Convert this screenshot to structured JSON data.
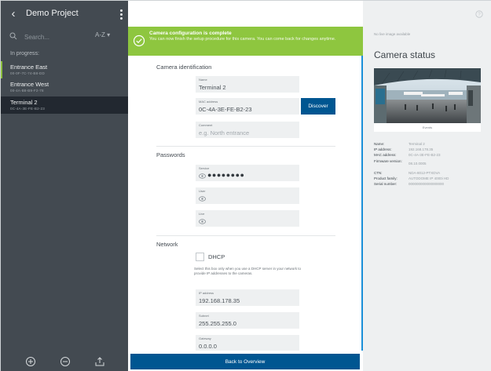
{
  "sidebar": {
    "project_title": "Demo Project",
    "search_placeholder": "Search...",
    "sort_label": "A-Z ▾",
    "section_label": "In progress:",
    "items": [
      {
        "name": "Entrance East",
        "mac": "00-0F-7C-74-B8-DD",
        "flag": true,
        "active": false
      },
      {
        "name": "Entrance West",
        "mac": "00-4A-B8-B9-F2-78",
        "flag": false,
        "active": false
      },
      {
        "name": "Terminal 2",
        "mac": "0C-4A-3E-FE-B2-23",
        "flag": false,
        "active": true
      }
    ],
    "footer_icons": [
      "add-circle-icon",
      "remove-circle-icon",
      "upload-icon"
    ]
  },
  "banner": {
    "title": "Camera configuration is complete",
    "text": "You can now finish the setup procedure for this camera. You can come back for changes anytime.",
    "color": "#8ec63f"
  },
  "identification": {
    "title": "Camera identification",
    "name_label": "Name",
    "name_value": "Terminal 2",
    "mac_label": "MAC address",
    "mac_value": "0C-4A-3E-FE-B2-23",
    "discover_label": "Discover",
    "comment_label": "Comment",
    "comment_placeholder": "e.g. North entrance"
  },
  "passwords": {
    "title": "Passwords",
    "service_label": "Service",
    "service_mask": "●●●●●●●●",
    "user_label": "User",
    "live_label": "Live"
  },
  "network": {
    "title": "Network",
    "dhcp_label": "DHCP",
    "dhcp_help": "Select this box only when you use a DHCP server in your network to provide IP addresses to the cameras.",
    "ip_label": "IP address",
    "ip_value": "192.168.178.35",
    "subnet_label": "Subnet",
    "subnet_value": "255.255.255.0",
    "gateway_label": "Gateway",
    "gateway_value": "0.0.0.0"
  },
  "footer": {
    "back_label": "Back to Overview",
    "color": "#005691"
  },
  "status": {
    "no_live_text": "No live image available",
    "title": "Camera status",
    "image_caption": "Events",
    "info": [
      {
        "key": "Name:",
        "value": "Terminal 2"
      },
      {
        "key": "IP address:",
        "value": "192.168.178.35"
      },
      {
        "key": "MAC address:",
        "value": "0C-4A-3E-FE-B2-23"
      },
      {
        "key": "Firmware version:",
        "value": "08.10.0005"
      },
      {
        "key": "CTN:",
        "value": "NDA-8012-PTXDVA"
      },
      {
        "key": "Product family:",
        "value": "AUTODOME IP 4000i HD"
      },
      {
        "key": "Serial number:",
        "value": "000000000000000000"
      }
    ]
  },
  "accent_color": "#1a8fd8",
  "sidebar_color": "#434a51"
}
